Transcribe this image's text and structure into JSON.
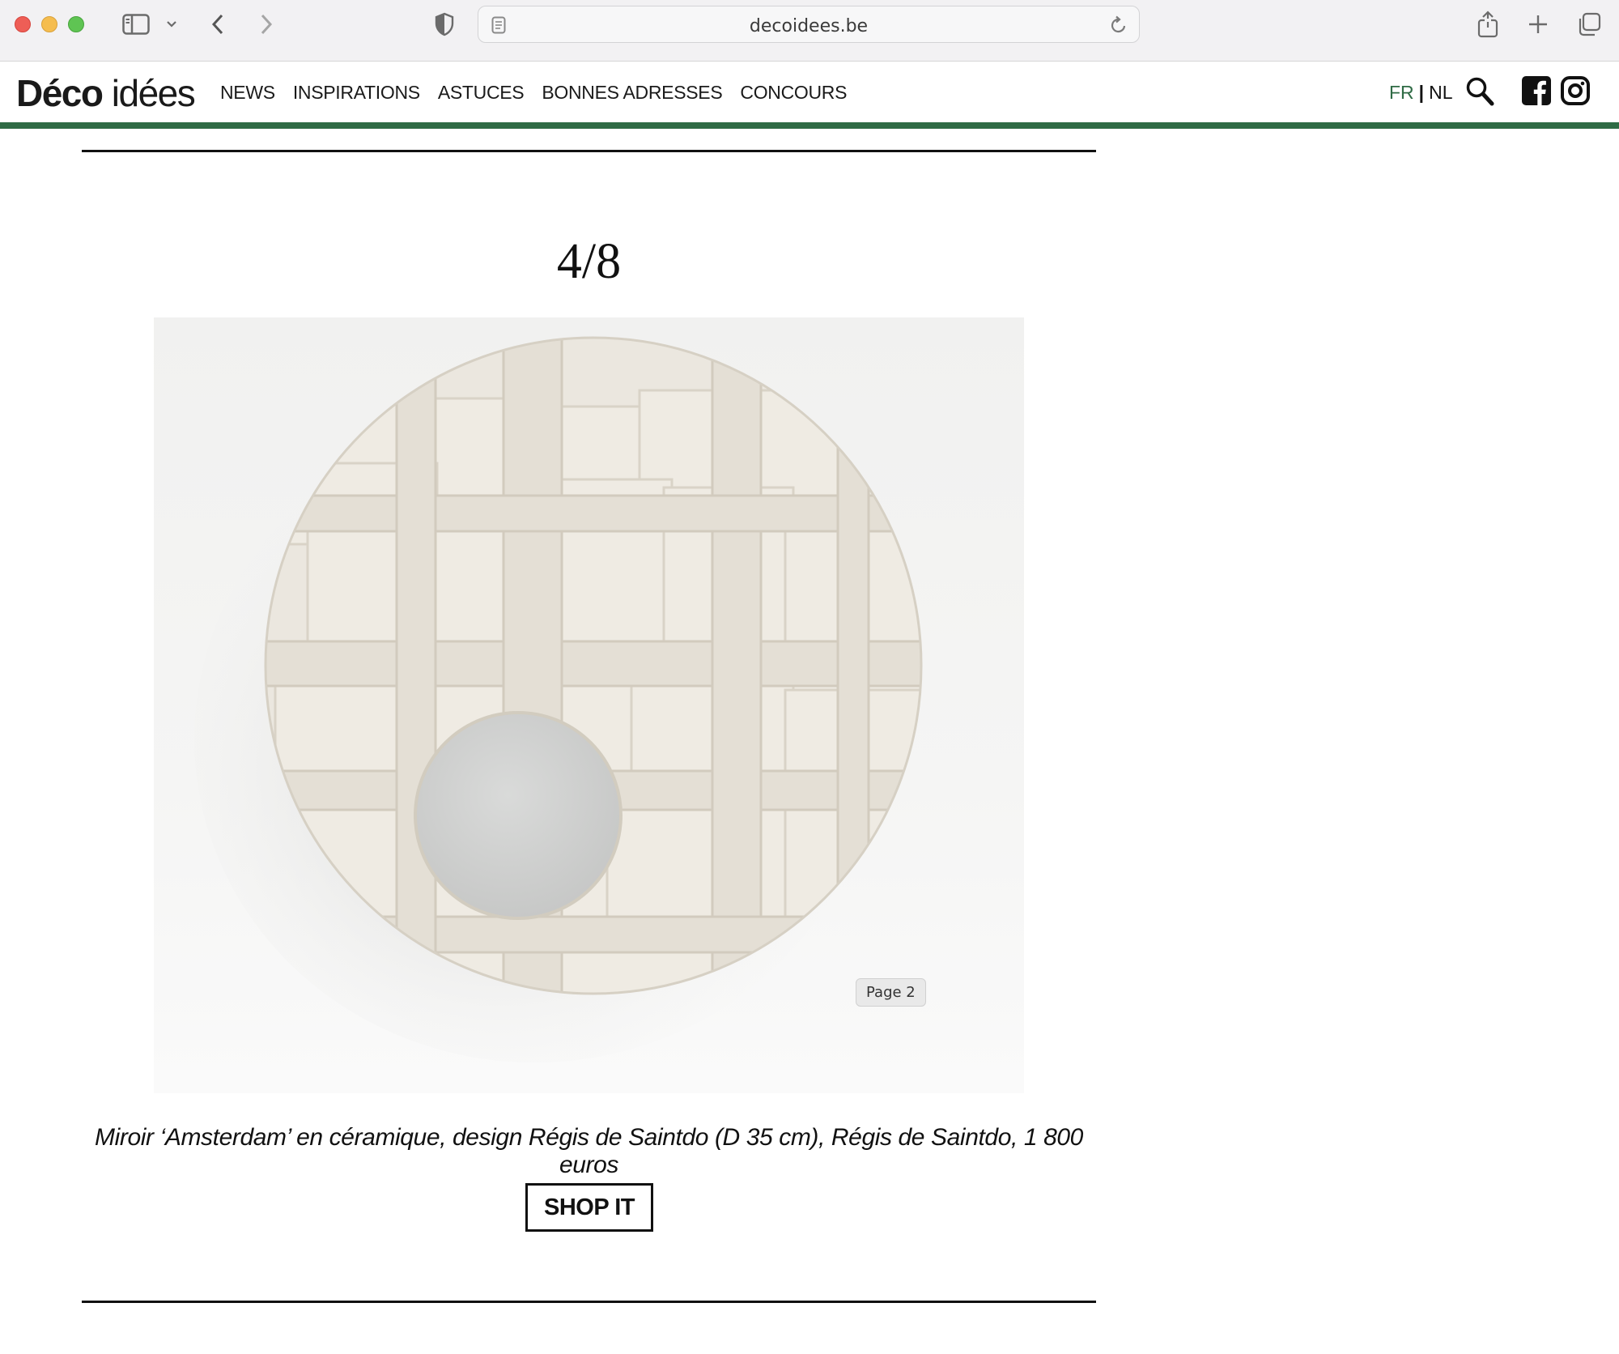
{
  "browser": {
    "url": "decoidees.be"
  },
  "site": {
    "logo_bold": "Déco",
    "logo_light": "idées",
    "nav": [
      {
        "label": "NEWS"
      },
      {
        "label": "INSPIRATIONS"
      },
      {
        "label": "ASTUCES"
      },
      {
        "label": "BONNES ADRESSES"
      },
      {
        "label": "CONCOURS"
      }
    ],
    "lang_fr": "FR",
    "lang_sep": "|",
    "lang_nl": "NL",
    "accent_color": "#2f6b45"
  },
  "slide": {
    "counter": "4/8",
    "page_badge": "Page 2",
    "caption": "Miroir ‘Amsterdam’ en céramique, design Régis de Saintdo (D 35 cm), Régis de Saintdo, 1 800 euros",
    "shop_label": "SHOP IT"
  }
}
